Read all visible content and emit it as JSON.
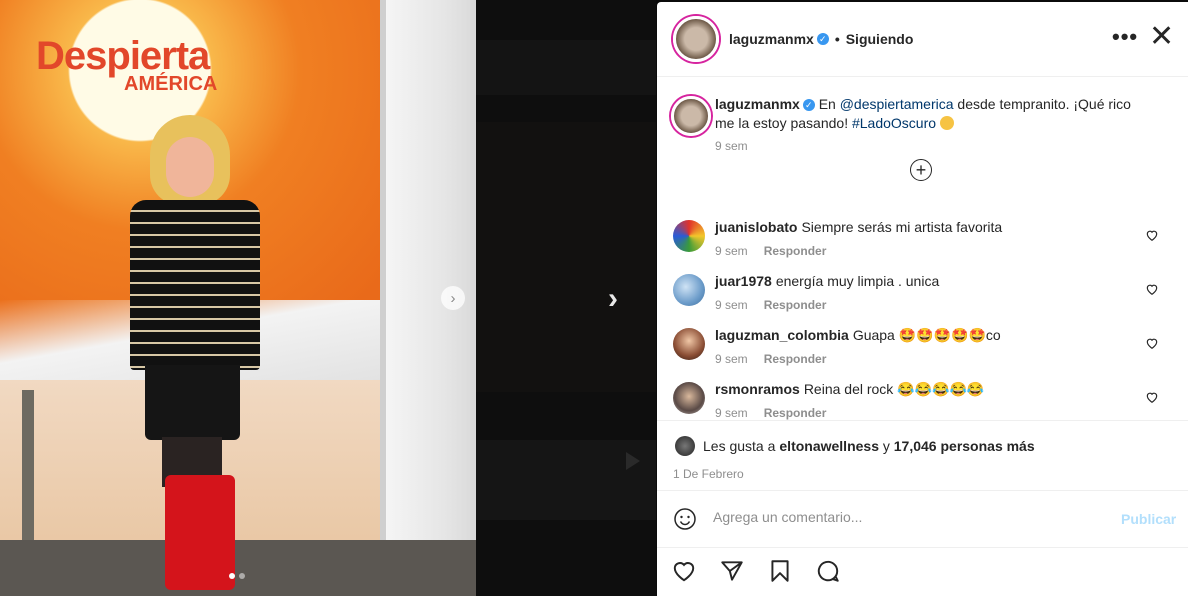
{
  "photo": {
    "logo_line1": "Despierta",
    "logo_line2": "AMÉRICA",
    "carousel_position": 1,
    "carousel_total": 2,
    "next_icon": "chevron-right-icon"
  },
  "navigation": {
    "next_arrow": "›"
  },
  "header": {
    "username": "laguzmanmx",
    "verified_mark": "✓",
    "separator": "•",
    "follow_label": "Siguiendo",
    "more_label": "•••",
    "close_label": "✕"
  },
  "caption": {
    "username": "laguzmanmx",
    "text_before": "En ",
    "mention": "@despiertamerica",
    "text_mid": " desde tempranito. ¡Qué rico me la estoy pasando! ",
    "hashtag": "#LadoOscuro",
    "time": "9 sem",
    "load_more_label": "+"
  },
  "comments": [
    {
      "user": "juanislobato",
      "text": "Siempre serás mi artista favorita",
      "time": "9 sem",
      "reply": "Responder",
      "avatar_color": "#4b7a3a"
    },
    {
      "user": "juar1978",
      "text": "energía muy limpia . unica",
      "time": "9 sem",
      "reply": "Responder",
      "avatar_color": "#7aa7d6"
    },
    {
      "user": "laguzman_colombia",
      "text": "Guapa 🤩🤩🤩🤩🤩co",
      "time": "9 sem",
      "reply": "Responder",
      "avatar_color": "#6b4a3a"
    },
    {
      "user": "rsmonramos",
      "text": "Reina del rock 😂😂😂😂😂",
      "time": "9 sem",
      "reply": "Responder",
      "avatar_color": "#8a7f7a"
    }
  ],
  "likes": {
    "prefix": "Les gusta a ",
    "liker": "eltonawellness",
    "middle": " y ",
    "count": "17,046 personas más",
    "date": "1 De Febrero"
  },
  "add_comment": {
    "placeholder": "Agrega un comentario...",
    "publish_label": "Publicar"
  },
  "colors": {
    "link": "#00376b",
    "verified": "#3897f0",
    "publish_disabled": "#b2dffc",
    "secondary_text": "#8e8e8e"
  }
}
